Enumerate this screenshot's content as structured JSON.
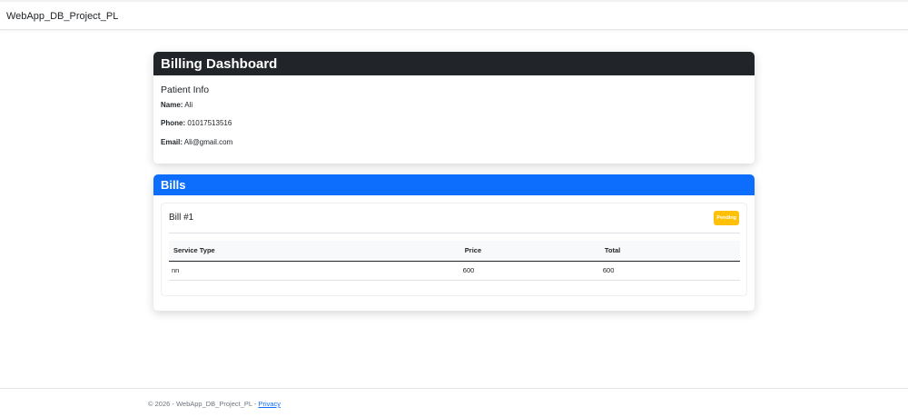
{
  "navbar": {
    "brand": "WebApp_DB_Project_PL"
  },
  "dashboard": {
    "title": "Billing Dashboard",
    "patient_section_title": "Patient Info",
    "name_label": "Name:",
    "name_value": "Ali",
    "phone_label": "Phone:",
    "phone_value": "01017513516",
    "email_label": "Email:",
    "email_value": "Ali@gmail.com"
  },
  "bills": {
    "title": "Bills",
    "items": [
      {
        "title": "Bill #1",
        "status": "Pending",
        "columns": [
          "Service Type",
          "Price",
          "Total"
        ],
        "rows": [
          [
            "nn",
            "600",
            "600"
          ]
        ]
      }
    ]
  },
  "footer": {
    "text": "© 2026 - WebApp_DB_Project_PL - ",
    "privacy_link": "Privacy"
  },
  "colors": {
    "dark_header": "#212529",
    "primary_header": "#0d6efd",
    "pending_badge": "#ffc107"
  }
}
